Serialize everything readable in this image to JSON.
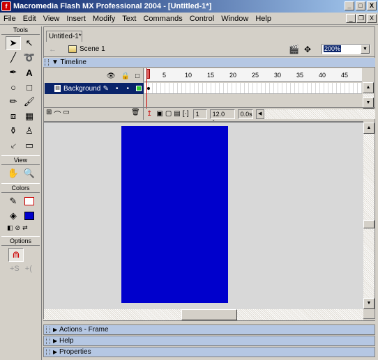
{
  "window": {
    "title": "Macromedia Flash MX Professional 2004 - [Untitled-1*]",
    "app_icon": "flash-icon",
    "buttons": [
      "_",
      "□",
      "X"
    ]
  },
  "menubar": {
    "items": [
      "File",
      "Edit",
      "View",
      "Insert",
      "Modify",
      "Text",
      "Commands",
      "Control",
      "Window",
      "Help"
    ],
    "doc_buttons": [
      "_",
      "❐",
      "X"
    ]
  },
  "tools": {
    "header": "Tools",
    "view_header": "View",
    "colors_header": "Colors",
    "options_header": "Options",
    "fill_color": "#0000cc",
    "stroke_color": "#cc0000",
    "selected_tool": "arrow-tool"
  },
  "document": {
    "tab_label": "Untitled-1*",
    "scene_label": "Scene 1",
    "zoom": "200%"
  },
  "timeline": {
    "header": "Timeline",
    "ruler_numbers": [
      "1",
      "5",
      "10",
      "15",
      "20",
      "25",
      "30",
      "35",
      "40",
      "45"
    ],
    "layer_name": "Background",
    "current_frame": "1",
    "frame_rate": "12.0 fps",
    "elapsed": "0.0s"
  },
  "stage": {
    "background_color": "#0000cc"
  },
  "panels": {
    "actions": "Actions - Frame",
    "help": "Help",
    "properties": "Properties"
  }
}
